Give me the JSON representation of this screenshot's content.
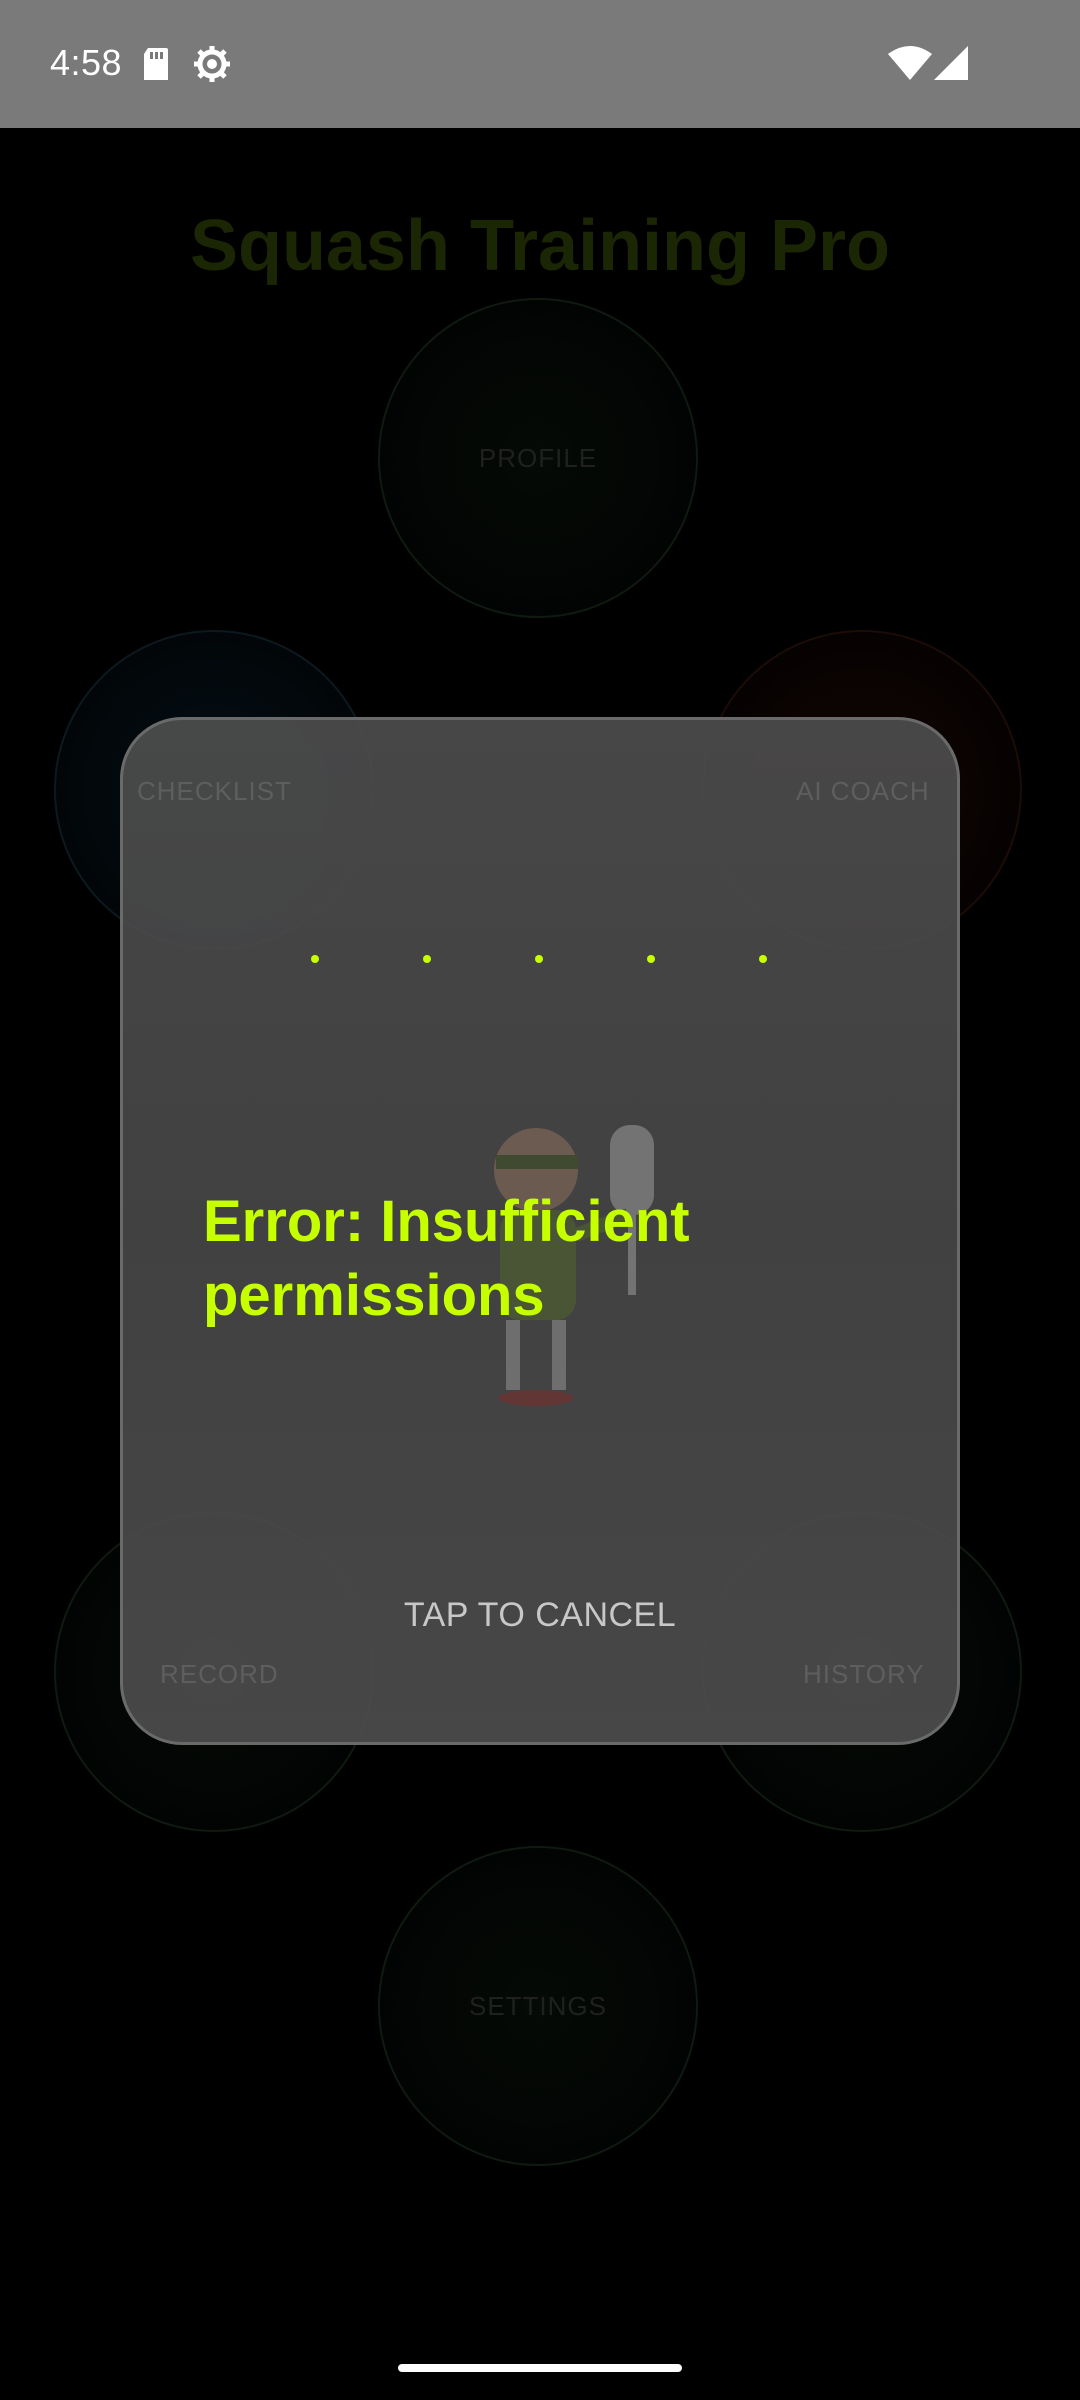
{
  "status_bar": {
    "time": "4:58",
    "icons": [
      "sd-card-icon",
      "gear-icon",
      "wifi-icon",
      "cell-signal-icon"
    ]
  },
  "app": {
    "title": "Squash Training Pro",
    "menu": {
      "profile": "PROFILE",
      "checklist": "CHECKLIST",
      "ai_coach": "AI COACH",
      "record": "RECORD",
      "history": "HISTORY",
      "settings": "SETTINGS"
    }
  },
  "dialog": {
    "error_message": "Error: Insufficient permissions",
    "cancel_label": "TAP TO CANCEL",
    "loading_dots": 5,
    "mascot_icon": "android-mascot-with-racket-icon"
  },
  "colors": {
    "accent": "#c6ff00",
    "dialog_bg": "#484848",
    "status_bar_bg": "#7a7a7a"
  }
}
